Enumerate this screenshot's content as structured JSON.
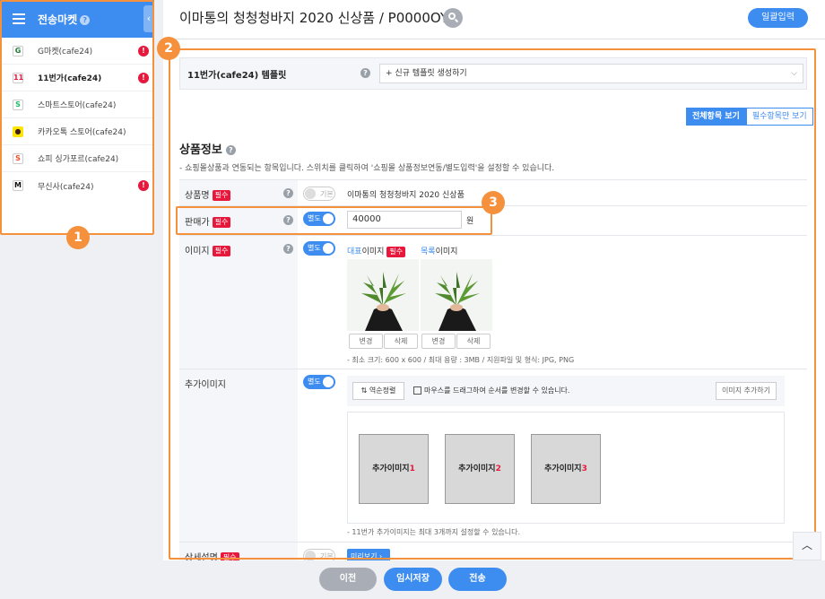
{
  "sidebar": {
    "title": "전송마켓",
    "help": "?",
    "collapse": "‹",
    "items": [
      {
        "icon": "G",
        "iconColor": "#1e7b34",
        "label": "G마켓(cafe24)",
        "alert": "!"
      },
      {
        "icon": "11",
        "iconColor": "#e8173c",
        "label": "11번가(cafe24)",
        "alert": "!"
      },
      {
        "icon": "S",
        "iconColor": "#1fb866",
        "label": "스마트스토어(cafe24)",
        "alert": ""
      },
      {
        "icon": "●",
        "iconColor": "#3a1d1d",
        "label": "카카오톡 스토어(cafe24)",
        "alert": ""
      },
      {
        "icon": "S",
        "iconColor": "#ee4d2d",
        "label": "쇼피 싱가포르(cafe24)",
        "alert": ""
      },
      {
        "icon": "M",
        "iconColor": "#111111",
        "label": "무신사(cafe24)",
        "alert": "!"
      }
    ]
  },
  "callouts": [
    "1",
    "2",
    "3"
  ],
  "header": {
    "title": "이마통의 청청청바지 2020 신상품 / P0000OYW",
    "bulk_input": "일괄입력"
  },
  "template": {
    "label": "11번가(cafe24) 템플릿",
    "help": "?",
    "select_value": "+ 신규 템플릿 생성하기",
    "chevron": "⌵"
  },
  "view_tabs": {
    "all": "전체항목 보기",
    "required": "필수항목만 보기"
  },
  "section": {
    "title": "상품정보",
    "help": "?",
    "desc": "- 쇼핑몰상품과 연동되는 항목입니다. 스위치를 클릭하여 '쇼핑몰 상품정보연동/별도입력'을 설정할 수 있습니다."
  },
  "req_tag": "필수",
  "fields": {
    "name": {
      "label": "상품명",
      "help": "?",
      "toggle": "기본",
      "value": "이마통의 청청청바지 2020 신상품"
    },
    "price": {
      "label": "판매가",
      "help": "?",
      "toggle": "별도",
      "value": "40000",
      "unit": "원"
    },
    "image": {
      "label": "이미지",
      "help": "?",
      "toggle": "별도",
      "main_head_a": "대표",
      "main_head_b": "이미지",
      "list_head_a": "목록",
      "list_head_b": "이미지",
      "change": "변경",
      "delete": "삭제",
      "note": "- 최소 크기: 600 x 600 / 최대 용량 : 3MB / 지원파일 및 형식: JPG, PNG"
    },
    "extra": {
      "label": "추가이미지",
      "toggle": "별도",
      "sort": "⇅ 역순정렬",
      "drag_tip": "마우스를 드래그하여 순서를 변경할 수 있습니다.",
      "add": "이미지 추가하기",
      "slot_label": "추가이미지",
      "slots": [
        "1",
        "2",
        "3"
      ],
      "note": "- 11번가 추가이미지는 최대 3개까지 설정할 수 있습니다."
    },
    "detail": {
      "label": "상세설명",
      "toggle": "기본",
      "preview": "미리보기 ›"
    }
  },
  "scroll_top": "︿",
  "footer": {
    "prev": "이전",
    "save": "임시저장",
    "send": "전송"
  }
}
